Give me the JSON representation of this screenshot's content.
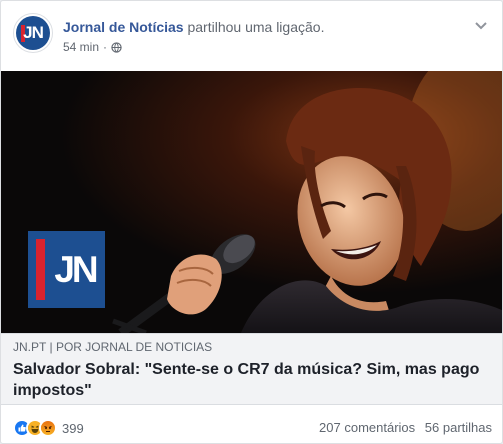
{
  "post": {
    "page_name": "Jornal de Notícias",
    "action_text": "partilhou uma ligação.",
    "time": "54 min",
    "separator": "·",
    "avatar_text": "JN",
    "icons": {
      "audience": "globe-icon",
      "options": "chevron-down-icon"
    }
  },
  "media": {
    "logo_text": "JN",
    "colors": {
      "logo_blue": "#1d4f91",
      "logo_red": "#d9232e"
    }
  },
  "link": {
    "domain": "JN.PT",
    "divider": "|",
    "byline": "POR JORNAL DE NOTICIAS",
    "headline": "Salvador Sobral: \"Sente-se o CR7 da música? Sim, mas pago impostos\""
  },
  "footer": {
    "reaction_icons": [
      "like-icon",
      "haha-icon",
      "angry-icon"
    ],
    "reaction_count": "399",
    "comments": "207 comentários",
    "shares": "56 partilhas"
  }
}
